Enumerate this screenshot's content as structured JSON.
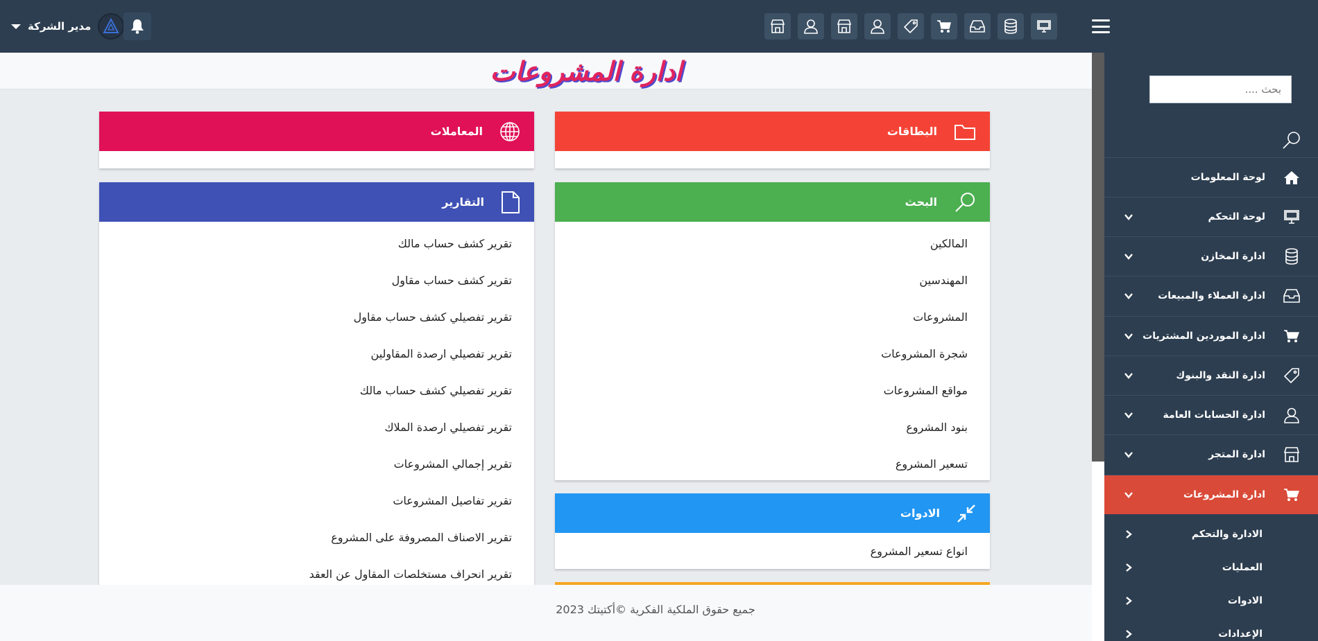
{
  "header": {
    "user_name": "مدير الشركة",
    "toolbar_icons": [
      "store-icon",
      "user-icon",
      "store-icon",
      "user-icon",
      "tag-icon",
      "cart-icon",
      "inbox-icon",
      "database-icon",
      "monitor-icon"
    ]
  },
  "page": {
    "title": "ادارة المشروعات"
  },
  "cards": {
    "cards_panel": {
      "title": "البطاقات",
      "color": "#f44336"
    },
    "transactions": {
      "title": "المعاملات",
      "color": "#e01157"
    },
    "search": {
      "title": "البحث",
      "color": "#4caf50",
      "items": [
        "المالكين",
        "المهندسين",
        "المشروعات",
        "شجرة المشروعات",
        "مواقع المشروعات",
        "بنود المشروع",
        "تسعير المشروع"
      ]
    },
    "reports": {
      "title": "التقارير",
      "color": "#3f51b5",
      "items": [
        "تقرير كشف حساب مالك",
        "تقرير كشف حساب مقاول",
        "تقرير تفصيلي كشف حساب مقاول",
        "تقرير تفصيلي ارصدة المقاولين",
        "تقرير تفصيلي كشف حساب مالك",
        "تقرير تفصيلي ارصدة الملاك",
        "تقرير إجمالي المشروعات",
        "تقرير تفاصيل المشروعات",
        "تقرير الاصناف المصروفة على المشروع",
        "تقرير انحراف مستخلصات المقاول عن العقد"
      ]
    },
    "tools": {
      "title": "الادوات",
      "color": "#2196f3",
      "items": [
        "انواع تسعير المشروع"
      ]
    }
  },
  "footer": {
    "text": "جميع حقوق الملكية الفكرية ©أكتيتك 2023"
  },
  "sidebar": {
    "search_placeholder": "بحث ....",
    "items": [
      {
        "label": "لوحة المعلومات",
        "icon": "home-icon"
      },
      {
        "label": "لوحة التحكم",
        "icon": "monitor-icon"
      },
      {
        "label": "ادارة المخازن",
        "icon": "database-icon"
      },
      {
        "label": "ادارة العملاء والمبيعات",
        "icon": "inbox-icon"
      },
      {
        "label": "ادارة الموردين المشتريات",
        "icon": "cart-icon"
      },
      {
        "label": "ادارة النقد والبنوك",
        "icon": "tag-icon"
      },
      {
        "label": "ادارة الحسابات العامة",
        "icon": "user-icon"
      },
      {
        "label": "ادارة المتجر",
        "icon": "store-icon"
      },
      {
        "label": "ادارة المشروعات",
        "icon": "cart-icon"
      }
    ],
    "sub_items": [
      "الادارة والتحكم",
      "العمليات",
      "الادوات",
      "الإعدادات"
    ],
    "active_color": "#d94a38"
  }
}
